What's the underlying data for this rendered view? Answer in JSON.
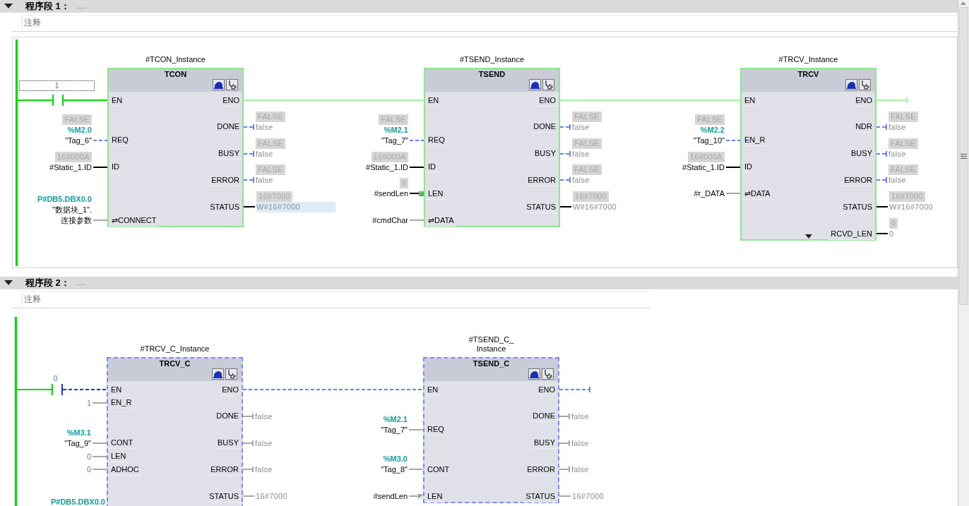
{
  "networks": [
    {
      "title": "程序段 1：",
      "dots": ".....",
      "comment": "注释",
      "contact": {
        "value": "1",
        "closed": true,
        "focused": true
      },
      "blocks": [
        {
          "instance": "#TCON_Instance",
          "type": "TCON",
          "active": true,
          "collapsed": false,
          "inputs": [
            {
              "pin": "EN"
            },
            {
              "pin": "REQ",
              "monitor": "FALSE",
              "address": "%M2.0",
              "operand": "\"Tag_6\"",
              "kind": "dashed"
            },
            {
              "pin": "ID",
              "monitor": "16#000A",
              "operand": "#Static_1.ID",
              "kind": "solid"
            },
            {
              "pin": "⇌CONNECT",
              "address": "P#DB5.DBX0.0",
              "operand": "\"数据块_1\".\n连接参数",
              "kind": "grey"
            }
          ],
          "outputs": [
            {
              "pin": "ENO",
              "kind": "green"
            },
            {
              "pin": "DONE",
              "monitor": "FALSE",
              "value": "false",
              "kind": "dashed"
            },
            {
              "pin": "BUSY",
              "monitor": "FALSE",
              "value": "false",
              "kind": "dashed"
            },
            {
              "pin": "ERROR",
              "monitor": "FALSE",
              "value": "false",
              "kind": "dashed"
            },
            {
              "pin": "STATUS",
              "monitor": "16#7000",
              "value": "W#16#7000",
              "kind": "solid",
              "highlighted": true
            }
          ]
        },
        {
          "instance": "#TSEND_Instance",
          "type": "TSEND",
          "active": true,
          "collapsed": false,
          "inputs": [
            {
              "pin": "EN"
            },
            {
              "pin": "REQ",
              "monitor": "FALSE",
              "address": "%M2.1",
              "operand": "\"Tag_7\"",
              "kind": "dashed"
            },
            {
              "pin": "ID",
              "monitor": "16#000A",
              "operand": "#Static_1.ID",
              "kind": "solid"
            },
            {
              "pin": "LEN",
              "monitor": "9",
              "operand": "#sendLen",
              "kind": "solid",
              "converted": true
            },
            {
              "pin": "⇌DATA",
              "operand": "#cmdChar",
              "kind": "grey"
            }
          ],
          "outputs": [
            {
              "pin": "ENO",
              "kind": "green"
            },
            {
              "pin": "DONE",
              "monitor": "FALSE",
              "value": "false",
              "kind": "dashed"
            },
            {
              "pin": "BUSY",
              "monitor": "FALSE",
              "value": "false",
              "kind": "dashed"
            },
            {
              "pin": "ERROR",
              "monitor": "FALSE",
              "value": "false",
              "kind": "dashed"
            },
            {
              "pin": "STATUS",
              "monitor": "16#7000",
              "value": "W#16#7000",
              "kind": "solid",
              "highlighted": false
            }
          ]
        },
        {
          "instance": "#TRCV_Instance",
          "type": "TRCV",
          "active": true,
          "collapsed": true,
          "inputs": [
            {
              "pin": "EN"
            },
            {
              "pin": "EN_R",
              "monitor": "FALSE",
              "address": "%M2.2",
              "operand": "\"Tag_10\"",
              "kind": "dashed"
            },
            {
              "pin": "ID",
              "monitor": "16#000A",
              "operand": "#Static_1.ID",
              "kind": "solid"
            },
            {
              "pin": "⇌DATA",
              "operand": "#r_DATA",
              "kind": "grey"
            }
          ],
          "outputs": [
            {
              "pin": "ENO",
              "kind": "green"
            },
            {
              "pin": "NDR",
              "monitor": "FALSE",
              "value": "false",
              "kind": "dashed"
            },
            {
              "pin": "BUSY",
              "monitor": "FALSE",
              "value": "false",
              "kind": "dashed"
            },
            {
              "pin": "ERROR",
              "monitor": "FALSE",
              "value": "false",
              "kind": "dashed"
            },
            {
              "pin": "STATUS",
              "monitor": "16#7000",
              "value": "W#16#7000",
              "kind": "solid"
            },
            {
              "pin": "RCVD_LEN",
              "monitor": "0",
              "value": "0",
              "kind": "solid"
            }
          ]
        }
      ]
    },
    {
      "title": "程序段 2：",
      "dots": ".....",
      "comment": "注释",
      "contact": {
        "value": "0",
        "closed": false,
        "focused": false
      },
      "blocks": [
        {
          "instance": "#TRCV_C_Instance",
          "type": "TRCV_C",
          "active": false,
          "inputs": [
            {
              "pin": "EN"
            },
            {
              "pin": "EN_R",
              "operand": "1",
              "constant": true,
              "kind": "grey"
            },
            {
              "pin": "CONT",
              "address": "%M3.1",
              "operand": "\"Tag_9\"",
              "kind": "grey"
            },
            {
              "pin": "LEN",
              "operand": "0",
              "constant": true,
              "kind": "grey"
            },
            {
              "pin": "ADHOC",
              "operand": "0",
              "constant": true,
              "kind": "grey"
            },
            {
              "address": "P#DB5.DBX0.0"
            }
          ],
          "outputs": [
            {
              "pin": "ENO",
              "kind": "dashed"
            },
            {
              "pin": "DONE",
              "value": "false",
              "kind": "grey"
            },
            {
              "pin": "BUSY",
              "value": "false",
              "kind": "grey"
            },
            {
              "pin": "ERROR",
              "value": "false",
              "kind": "grey"
            },
            {
              "pin": "STATUS",
              "value": "16#7000",
              "kind": "dim"
            }
          ]
        },
        {
          "instance": "#TSEND_C_\nInstance",
          "type": "TSEND_C",
          "active": false,
          "inputs": [
            {
              "pin": "EN"
            },
            {
              "pin": "REQ",
              "address": "%M2.1",
              "operand": "\"Tag_7\"",
              "kind": "grey"
            },
            {
              "pin": "CONT",
              "address": "%M3.0",
              "operand": "\"Tag_8\"",
              "kind": "grey"
            },
            {
              "pin": "LEN",
              "operand": "#sendLen",
              "kind": "grey",
              "converted": true
            }
          ],
          "outputs": [
            {
              "pin": "ENO",
              "kind": "dashed"
            },
            {
              "pin": "DONE",
              "value": "false",
              "kind": "grey"
            },
            {
              "pin": "BUSY",
              "value": "false",
              "kind": "grey"
            },
            {
              "pin": "ERROR",
              "value": "false",
              "kind": "grey"
            },
            {
              "pin": "STATUS",
              "value": "16#7000",
              "kind": "dim"
            }
          ]
        }
      ]
    }
  ]
}
